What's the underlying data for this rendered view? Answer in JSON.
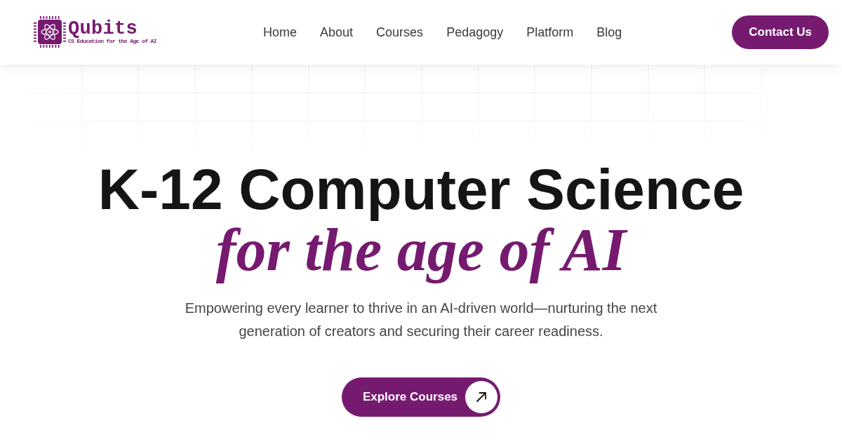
{
  "header": {
    "logo": {
      "name": "Qubits",
      "tagline": "CS Education for the Age of AI"
    },
    "nav": [
      "Home",
      "About",
      "Courses",
      "Pedagogy",
      "Platform",
      "Blog"
    ],
    "cta": "Contact Us"
  },
  "hero": {
    "title": "K-12 Computer Science",
    "title_accent": "for the age of AI",
    "subtitle": "Empowering every learner to thrive in an AI-driven world—nurturing the next generation of creators and securing their career readiness.",
    "button": "Explore Courses"
  }
}
